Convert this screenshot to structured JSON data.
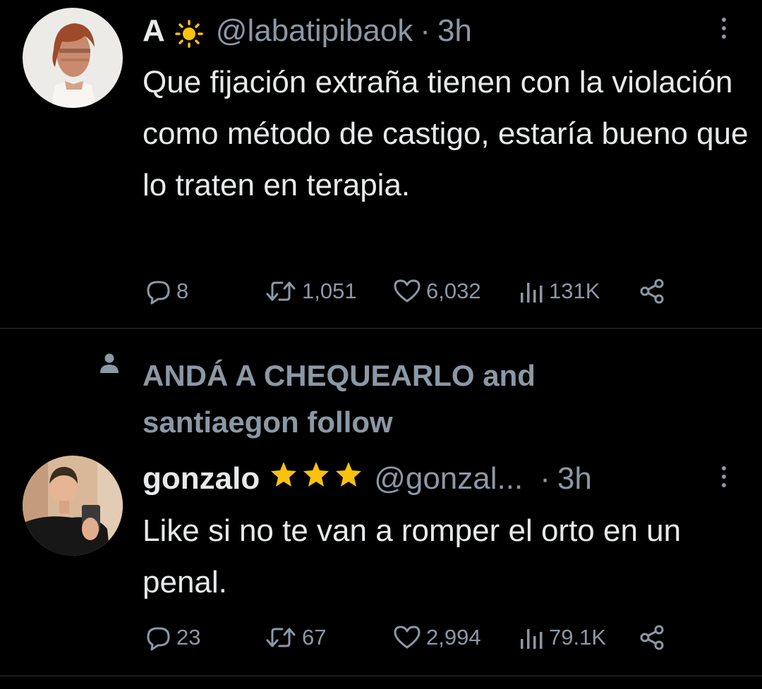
{
  "tweets": [
    {
      "display_name": "A",
      "badge_icon": "sun-icon",
      "handle": "@labatipibaok",
      "separator": "·",
      "time": "3h",
      "text": "Que fijación extraña tienen con la violación como método de castigo, estaría bueno que lo traten en terapia.",
      "replies": "8",
      "retweets": "1,051",
      "likes": "6,032",
      "views": "131K"
    },
    {
      "display_name": "gonzalo",
      "badge_icon": "star-icon",
      "handle": "@gonzal...",
      "separator": "·",
      "time": "3h",
      "text": "Like si no te van a romper el orto en un penal.",
      "replies": "23",
      "retweets": "67",
      "likes": "2,994",
      "views": "79.1K"
    }
  ],
  "social_context": {
    "text": "ANDÁ A CHEQUEARLO and santiaegon follow",
    "icon": "person-icon"
  },
  "colors": {
    "background": "#000000",
    "text_primary": "#e7e9ea",
    "text_secondary": "#8b98a5",
    "divider": "#2f3336",
    "badge_yellow": "#f9c20d"
  }
}
